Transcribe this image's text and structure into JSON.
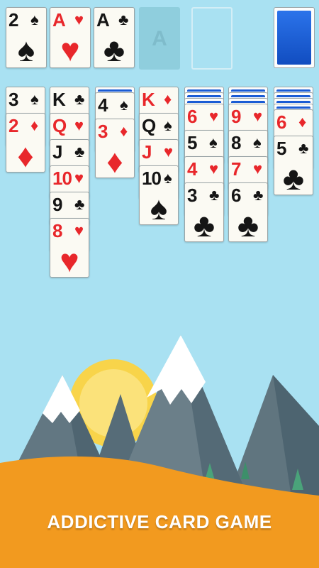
{
  "foundations": [
    {
      "rank": "2",
      "suit": "♠",
      "color": "black"
    },
    {
      "rank": "A",
      "suit": "♥",
      "color": "red"
    },
    {
      "rank": "A",
      "suit": "♣",
      "color": "black"
    }
  ],
  "empty_foundation_label": "A",
  "tableau": [
    {
      "facedown": 0,
      "cards": [
        {
          "rank": "3",
          "suit": "♠",
          "color": "black"
        },
        {
          "rank": "2",
          "suit": "♦",
          "color": "red"
        }
      ]
    },
    {
      "facedown": 0,
      "cards": [
        {
          "rank": "K",
          "suit": "♣",
          "color": "black"
        },
        {
          "rank": "Q",
          "suit": "♥",
          "color": "red"
        },
        {
          "rank": "J",
          "suit": "♣",
          "color": "black"
        },
        {
          "rank": "10",
          "suit": "♥",
          "color": "red"
        },
        {
          "rank": "9",
          "suit": "♣",
          "color": "black"
        },
        {
          "rank": "8",
          "suit": "♥",
          "color": "red"
        }
      ]
    },
    {
      "facedown": 1,
      "cards": [
        {
          "rank": "4",
          "suit": "♠",
          "color": "black"
        },
        {
          "rank": "3",
          "suit": "♦",
          "color": "red"
        }
      ]
    },
    {
      "facedown": 0,
      "cards": [
        {
          "rank": "K",
          "suit": "♦",
          "color": "red"
        },
        {
          "rank": "Q",
          "suit": "♠",
          "color": "black"
        },
        {
          "rank": "J",
          "suit": "♥",
          "color": "red"
        },
        {
          "rank": "10",
          "suit": "♠",
          "color": "black"
        }
      ]
    },
    {
      "facedown": 3,
      "cards": [
        {
          "rank": "6",
          "suit": "♥",
          "color": "red"
        },
        {
          "rank": "5",
          "suit": "♠",
          "color": "black"
        },
        {
          "rank": "4",
          "suit": "♥",
          "color": "red"
        },
        {
          "rank": "3",
          "suit": "♣",
          "color": "black"
        }
      ]
    },
    {
      "facedown": 3,
      "cards": [
        {
          "rank": "9",
          "suit": "♥",
          "color": "red"
        },
        {
          "rank": "8",
          "suit": "♠",
          "color": "black"
        },
        {
          "rank": "7",
          "suit": "♥",
          "color": "red"
        },
        {
          "rank": "6",
          "suit": "♣",
          "color": "black"
        }
      ]
    },
    {
      "facedown": 4,
      "cards": [
        {
          "rank": "6",
          "suit": "♦",
          "color": "red"
        },
        {
          "rank": "5",
          "suit": "♣",
          "color": "black"
        }
      ]
    }
  ],
  "caption": "ADDICTIVE CARD GAME",
  "colors": {
    "sky": "#a9e1f2",
    "card_red": "#e8272b",
    "card_black": "#151515",
    "card_back_blue": "#1a5bd4",
    "hill_orange": "#f29a1f",
    "sun": "#f8d44a",
    "mountain": "#5d7380",
    "snow": "#ffffff"
  }
}
